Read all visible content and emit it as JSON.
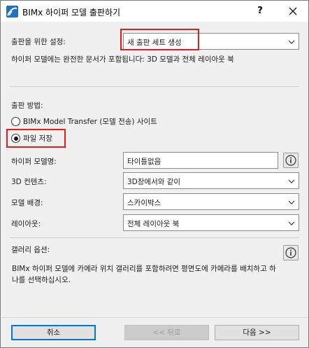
{
  "window": {
    "title": "BIMx 하이퍼 모델 출판하기",
    "help_label": "?"
  },
  "publish_settings": {
    "label": "출판을 위한 설정:",
    "selected": "새 출판 세트 생성",
    "description": "하이퍼 모델에는 완전한 문서가 포함됩니다: 3D 모델과 전체 레이아웃 북"
  },
  "publish_method": {
    "label": "출판 방법:",
    "options": [
      {
        "label": "BIMx Model Transfer (모델 전송) 사이트",
        "selected": false
      },
      {
        "label": "파일 저장",
        "selected": true
      }
    ]
  },
  "fields": {
    "model_name": {
      "label": "하이퍼 모델명:",
      "value": "타이틀없음"
    },
    "content_3d": {
      "label": "3D 컨텐츠:",
      "value": "3D창에서와 같이"
    },
    "background": {
      "label": "모델 배경:",
      "value": "스카이박스"
    },
    "layouts": {
      "label": "레이아웃:",
      "value": "전체 레이아웃 북"
    }
  },
  "gallery": {
    "label": "갤러리 옵션:",
    "text": "BIMx 하이퍼 모델에 카메라 위치 갤러리를 포함하려면 평면도에 카메라를 배치하고 하나를 선택하십시오."
  },
  "buttons": {
    "cancel": "취소",
    "back": "<< 뒤로",
    "next": "다음 >>"
  },
  "colors": {
    "highlight": "#e01e1e",
    "accent": "#0078d7"
  }
}
